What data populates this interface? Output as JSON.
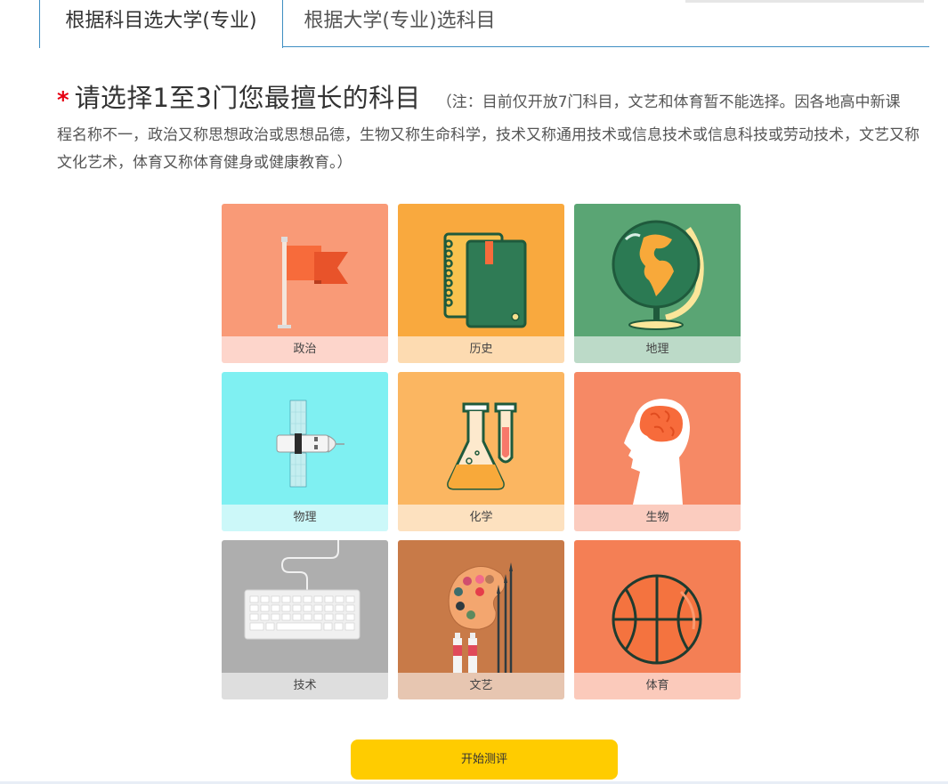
{
  "tabs": [
    {
      "label": "根据科目选大学(专业)",
      "active": true
    },
    {
      "label": "根据大学(专业)选科目",
      "active": false
    }
  ],
  "heading": {
    "star": "*",
    "title": "请选择1至3门您最擅长的科目",
    "note_first": "（注：目前仅开放7门科目，文艺和体育暂不能选择。因各地高中新课",
    "note_rest": "程名称不一，政治又称思想政治或思想品德，生物又称生命科学，技术又称通用技术或信息技术或信息科技或劳动技术，文艺又称文化艺术，体育又称体育健身或健康教育。）"
  },
  "subjects": [
    {
      "label": "政治",
      "icon": "flag-icon",
      "bg": "#f99a77",
      "label_bg": "#fdd5cb"
    },
    {
      "label": "历史",
      "icon": "book-icon",
      "bg": "#f9a93e",
      "label_bg": "#fddbb1"
    },
    {
      "label": "地理",
      "icon": "globe-icon",
      "bg": "#5aa574",
      "label_bg": "#bcdac8"
    },
    {
      "label": "物理",
      "icon": "satellite-icon",
      "bg": "#7ff0f2",
      "label_bg": "#ccf8f9"
    },
    {
      "label": "化学",
      "icon": "flask-icon",
      "bg": "#fbb661",
      "label_bg": "#fde1bf"
    },
    {
      "label": "生物",
      "icon": "brain-head-icon",
      "bg": "#f68965",
      "label_bg": "#fbccbf"
    },
    {
      "label": "技术",
      "icon": "keyboard-icon",
      "bg": "#aeaeae",
      "label_bg": "#dedede"
    },
    {
      "label": "文艺",
      "icon": "palette-icon",
      "bg": "#c87a48",
      "label_bg": "#e7c6b1"
    },
    {
      "label": "体育",
      "icon": "basketball-icon",
      "bg": "#f47f55",
      "label_bg": "#fbcabb"
    }
  ],
  "start_button": {
    "label": "开始测评",
    "color": "#ffcc00"
  }
}
